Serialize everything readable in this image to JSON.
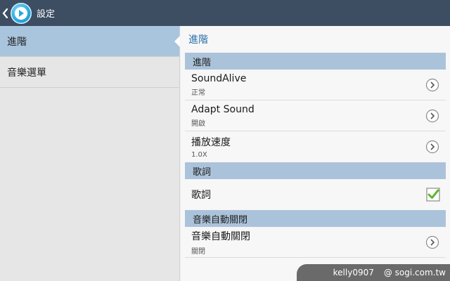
{
  "actionbar": {
    "title": "設定",
    "icon": "music-player-icon"
  },
  "sidebar": {
    "items": [
      {
        "label": "進階",
        "active": true
      },
      {
        "label": "音樂選單",
        "active": false
      }
    ]
  },
  "main": {
    "title": "進階",
    "sections": [
      {
        "header": "進階",
        "rows": [
          {
            "label": "SoundAlive",
            "sub": "正常",
            "control": "chevron"
          },
          {
            "label": "Adapt Sound",
            "sub": "開啟",
            "control": "chevron"
          },
          {
            "label": "播放速度",
            "sub": "1.0X",
            "control": "chevron"
          }
        ]
      },
      {
        "header": "歌詞",
        "rows": [
          {
            "label": "歌詞",
            "checked": true,
            "control": "checkbox"
          }
        ]
      },
      {
        "header": "音樂自動關閉",
        "rows": [
          {
            "label": "音樂自動關閉",
            "sub": "關閉",
            "control": "chevron"
          }
        ]
      }
    ]
  },
  "watermark": {
    "user": "kelly0907",
    "site": "@ sogi.com.tw"
  },
  "colors": {
    "actionbar": "#3d4e63",
    "section": "#abc3da",
    "active_sidebar": "#a9c4dd",
    "accent_title": "#2a6fa8",
    "check_green": "#5cb82e"
  }
}
